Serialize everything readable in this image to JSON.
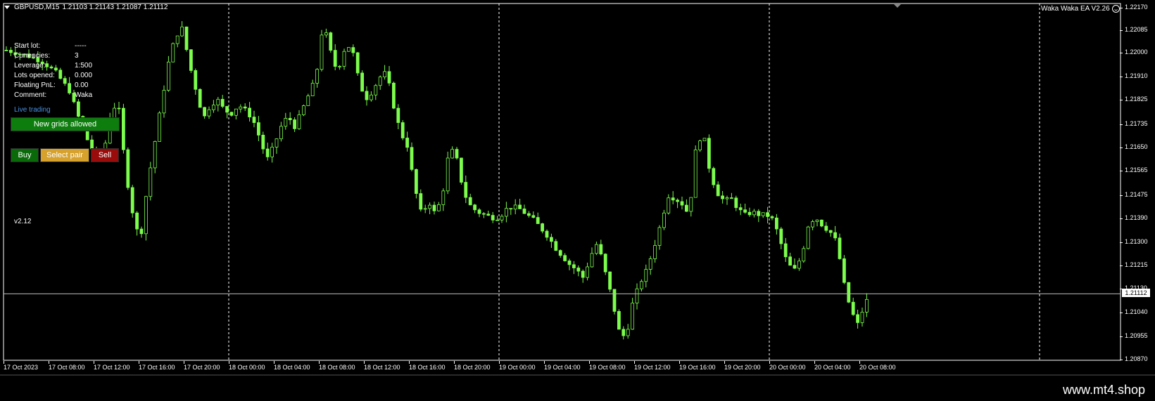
{
  "header": {
    "symbol": "GBPUSD,M15",
    "ohlc": "1.21103 1.21143 1.21087 1.21112"
  },
  "ea_label": "Waka Waka EA  V2.26",
  "info": [
    {
      "key": "Start lot:",
      "value": "-----"
    },
    {
      "key": "Currencies:",
      "value": "3"
    },
    {
      "key": "Leverage:",
      "value": "1:500"
    },
    {
      "key": "Lots opened:",
      "value": "0.000"
    },
    {
      "key": "Floating PnL:",
      "value": "0.00"
    },
    {
      "key": "Comment:",
      "value": "Waka"
    }
  ],
  "live_trading": "Live trading",
  "buttons": {
    "new_grids": "New grids allowed",
    "buy": "Buy",
    "select_pair": "Select pair",
    "sell": "Sell"
  },
  "version": "v2.12",
  "current_price": "1.21112",
  "watermark": "www.mt4.shop",
  "colors": {
    "background": "#000000",
    "candle": "#7CFC4C",
    "grid_green": "#0d7d0d",
    "buy_green": "#0a6a0a",
    "select_yellow": "#d6a12c",
    "sell_red": "#9a0b0b",
    "live_blue": "#4a90e2"
  },
  "chart_data": {
    "type": "candlestick",
    "symbol": "GBPUSD",
    "timeframe": "M15",
    "y_ticks": [
      "1.22170",
      "1.22085",
      "1.22000",
      "1.21910",
      "1.21825",
      "1.21735",
      "1.21650",
      "1.21565",
      "1.21475",
      "1.21390",
      "1.21300",
      "1.21215",
      "1.21130",
      "1.21040",
      "1.20955",
      "1.20870"
    ],
    "x_ticks": [
      "17 Oct 2023",
      "17 Oct 08:00",
      "17 Oct 12:00",
      "17 Oct 16:00",
      "17 Oct 20:00",
      "18 Oct 00:00",
      "18 Oct 04:00",
      "18 Oct 08:00",
      "18 Oct 12:00",
      "18 Oct 16:00",
      "18 Oct 20:00",
      "19 Oct 00:00",
      "19 Oct 04:00",
      "19 Oct 08:00",
      "19 Oct 12:00",
      "19 Oct 16:00",
      "19 Oct 20:00",
      "20 Oct 00:00",
      "20 Oct 04:00",
      "20 Oct 08:00"
    ],
    "ylim": [
      1.2087,
      1.2217
    ],
    "current_price": 1.21112,
    "price_path": [
      [
        0,
        1.22
      ],
      [
        3,
        1.2198
      ],
      [
        5,
        1.2196
      ],
      [
        7,
        1.2192
      ],
      [
        9,
        1.2185
      ],
      [
        11,
        1.217
      ],
      [
        13,
        1.216
      ],
      [
        14,
        1.2165
      ],
      [
        15,
        1.218
      ],
      [
        16,
        1.2178
      ],
      [
        17,
        1.2155
      ],
      [
        18,
        1.214
      ],
      [
        19,
        1.213
      ],
      [
        20,
        1.215
      ],
      [
        21,
        1.2165
      ],
      [
        22,
        1.218
      ],
      [
        23,
        1.2195
      ],
      [
        24,
        1.2205
      ],
      [
        25,
        1.2208
      ],
      [
        26,
        1.2195
      ],
      [
        27,
        1.2185
      ],
      [
        28,
        1.2175
      ],
      [
        29,
        1.218
      ],
      [
        30,
        1.2182
      ],
      [
        31,
        1.2178
      ],
      [
        32,
        1.2177
      ],
      [
        33,
        1.218
      ],
      [
        34,
        1.2178
      ],
      [
        35,
        1.2175
      ],
      [
        36,
        1.2168
      ],
      [
        37,
        1.216
      ],
      [
        38,
        1.2165
      ],
      [
        39,
        1.2172
      ],
      [
        40,
        1.2176
      ],
      [
        41,
        1.2172
      ],
      [
        42,
        1.2178
      ],
      [
        43,
        1.2184
      ],
      [
        44,
        1.219
      ],
      [
        45,
        1.221
      ],
      [
        46,
        1.22
      ],
      [
        47,
        1.2192
      ],
      [
        48,
        1.22
      ],
      [
        49,
        1.2202
      ],
      [
        50,
        1.219
      ],
      [
        51,
        1.2182
      ],
      [
        52,
        1.2185
      ],
      [
        53,
        1.219
      ],
      [
        54,
        1.2192
      ],
      [
        55,
        1.218
      ],
      [
        56,
        1.217
      ],
      [
        57,
        1.2165
      ],
      [
        58,
        1.215
      ],
      [
        59,
        1.214
      ],
      [
        60,
        1.2145
      ],
      [
        61,
        1.214
      ],
      [
        62,
        1.2148
      ],
      [
        63,
        1.2165
      ],
      [
        64,
        1.216
      ],
      [
        65,
        1.2148
      ],
      [
        66,
        1.2143
      ],
      [
        67,
        1.2141
      ],
      [
        68,
        1.214
      ],
      [
        69,
        1.2139
      ],
      [
        70,
        1.2139
      ],
      [
        71,
        1.2142
      ],
      [
        72,
        1.2143
      ],
      [
        73,
        1.2142
      ],
      [
        74,
        1.214
      ],
      [
        75,
        1.2138
      ],
      [
        76,
        1.2135
      ],
      [
        77,
        1.2132
      ],
      [
        78,
        1.2128
      ],
      [
        79,
        1.2125
      ],
      [
        80,
        1.2122
      ],
      [
        81,
        1.212
      ],
      [
        82,
        1.2117
      ],
      [
        83,
        1.2125
      ],
      [
        84,
        1.213
      ],
      [
        85,
        1.212
      ],
      [
        86,
        1.211
      ],
      [
        87,
        1.2098
      ],
      [
        88,
        1.2095
      ],
      [
        89,
        1.2108
      ],
      [
        90,
        1.2115
      ],
      [
        91,
        1.212
      ],
      [
        92,
        1.2128
      ],
      [
        93,
        1.2137
      ],
      [
        94,
        1.2147
      ],
      [
        95,
        1.2146
      ],
      [
        96,
        1.2144
      ],
      [
        97,
        1.214
      ],
      [
        98,
        1.2165
      ],
      [
        99,
        1.217
      ],
      [
        100,
        1.2155
      ],
      [
        101,
        1.2148
      ],
      [
        102,
        1.2145
      ],
      [
        103,
        1.2146
      ],
      [
        104,
        1.2142
      ],
      [
        105,
        1.214
      ],
      [
        106,
        1.2141
      ],
      [
        107,
        1.214
      ],
      [
        108,
        1.214
      ],
      [
        109,
        1.2138
      ],
      [
        110,
        1.213
      ],
      [
        111,
        1.2122
      ],
      [
        112,
        1.212
      ],
      [
        113,
        1.2125
      ],
      [
        114,
        1.2137
      ],
      [
        115,
        1.2139
      ],
      [
        116,
        1.2136
      ],
      [
        117,
        1.2134
      ],
      [
        118,
        1.213
      ],
      [
        119,
        1.2115
      ],
      [
        120,
        1.2105
      ],
      [
        121,
        1.21
      ],
      [
        122,
        1.2108
      ],
      [
        123,
        1.2111
      ]
    ]
  }
}
